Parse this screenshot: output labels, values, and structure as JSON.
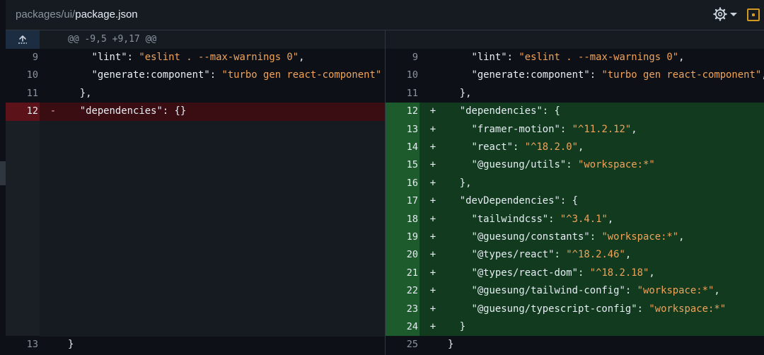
{
  "header": {
    "path_prefix": "packages/ui/",
    "file_name": "package.json"
  },
  "hunk": {
    "text": "@@ -9,5 +9,17 @@"
  },
  "icons": {
    "settings": "gear-icon",
    "dropdown": "chevron-down-icon",
    "view": "view-file-icon",
    "expand": "expand-up-icon"
  },
  "colors": {
    "deleted_bg": "#3a0d12",
    "added_bg": "#113a1f",
    "string": "#f0a35a",
    "accent": "#d29922"
  },
  "left": {
    "rows": [
      {
        "num": "9",
        "sign": "",
        "type": "ctx",
        "code": "    \"lint\": \"eslint . --max-warnings 0\","
      },
      {
        "num": "10",
        "sign": "",
        "type": "ctx",
        "code": "    \"generate:component\": \"turbo gen react-component\""
      },
      {
        "num": "11",
        "sign": "",
        "type": "ctx",
        "code": "  },"
      },
      {
        "num": "12",
        "sign": "-",
        "type": "del",
        "code": "  \"dependencies\": {}"
      },
      {
        "num": "13",
        "sign": "",
        "type": "ctx",
        "code": "}"
      }
    ]
  },
  "right": {
    "rows": [
      {
        "num": "9",
        "sign": "",
        "type": "ctx",
        "code": "    \"lint\": \"eslint . --max-warnings 0\","
      },
      {
        "num": "10",
        "sign": "",
        "type": "ctx",
        "code": "    \"generate:component\": \"turbo gen react-component\","
      },
      {
        "num": "11",
        "sign": "",
        "type": "ctx",
        "code": "  },"
      },
      {
        "num": "12",
        "sign": "+",
        "type": "add",
        "code": "  \"dependencies\": {"
      },
      {
        "num": "13",
        "sign": "+",
        "type": "add",
        "code": "    \"framer-motion\": \"^11.2.12\","
      },
      {
        "num": "14",
        "sign": "+",
        "type": "add",
        "code": "    \"react\": \"^18.2.0\","
      },
      {
        "num": "15",
        "sign": "+",
        "type": "add",
        "code": "    \"@guesung/utils\": \"workspace:*\""
      },
      {
        "num": "16",
        "sign": "+",
        "type": "add",
        "code": "  },"
      },
      {
        "num": "17",
        "sign": "+",
        "type": "add",
        "code": "  \"devDependencies\": {"
      },
      {
        "num": "18",
        "sign": "+",
        "type": "add",
        "code": "    \"tailwindcss\": \"^3.4.1\","
      },
      {
        "num": "19",
        "sign": "+",
        "type": "add",
        "code": "    \"@guesung/constants\": \"workspace:*\","
      },
      {
        "num": "20",
        "sign": "+",
        "type": "add",
        "code": "    \"@types/react\": \"^18.2.46\","
      },
      {
        "num": "21",
        "sign": "+",
        "type": "add",
        "code": "    \"@types/react-dom\": \"^18.2.18\","
      },
      {
        "num": "22",
        "sign": "+",
        "type": "add",
        "code": "    \"@guesung/tailwind-config\": \"workspace:*\","
      },
      {
        "num": "23",
        "sign": "+",
        "type": "add",
        "code": "    \"@guesung/typescript-config\": \"workspace:*\""
      },
      {
        "num": "24",
        "sign": "+",
        "type": "add",
        "code": "  }"
      },
      {
        "num": "25",
        "sign": "",
        "type": "ctx",
        "code": "}"
      }
    ]
  }
}
